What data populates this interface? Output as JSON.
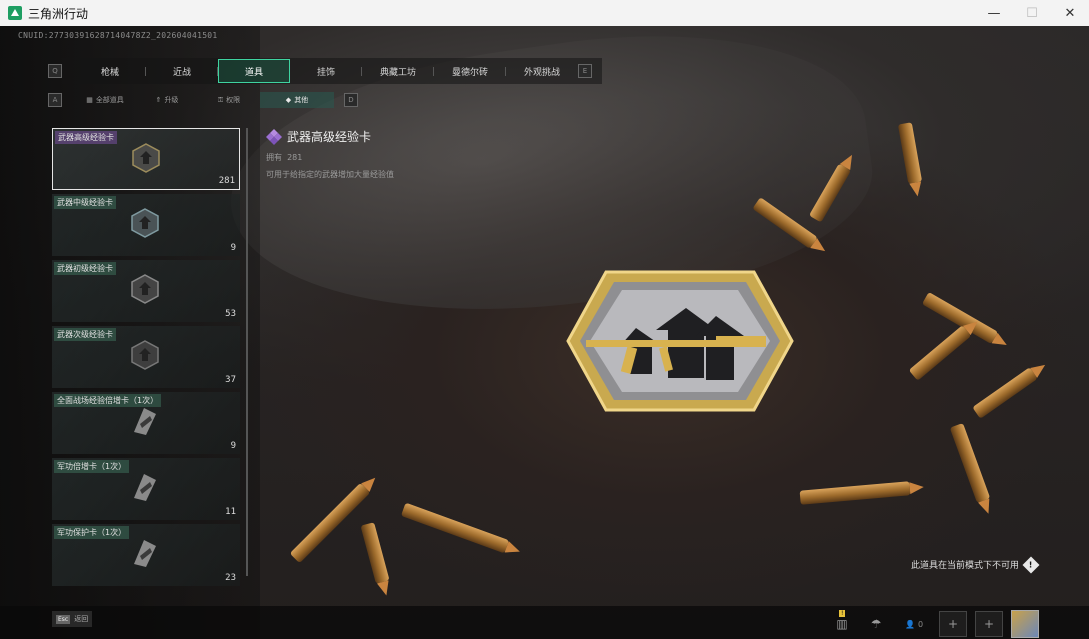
{
  "window": {
    "title": "三角洲行动",
    "minimize": "—",
    "maximize": "☐",
    "close": "✕"
  },
  "uid": "CNUID:277303916287140478Z2_202604041501",
  "tabs": {
    "prev_key": "Q",
    "next_key": "E",
    "items": [
      {
        "label": "枪械",
        "active": false
      },
      {
        "label": "近战",
        "active": false
      },
      {
        "label": "道具",
        "active": true
      },
      {
        "label": "挂饰",
        "active": false
      },
      {
        "label": "典藏工坊",
        "active": false
      },
      {
        "label": "曼德尔砖",
        "active": false
      },
      {
        "label": "外观挑战",
        "active": false
      }
    ]
  },
  "subtabs": {
    "prev_key": "A",
    "next_key": "D",
    "items": [
      {
        "label": "全部道具",
        "icon": "grid-icon",
        "active": false
      },
      {
        "label": "升级",
        "icon": "upgrade-icon",
        "active": false
      },
      {
        "label": "权限",
        "icon": "key-icon",
        "active": false
      },
      {
        "label": "其他",
        "icon": "diamond-icon",
        "active": true
      }
    ]
  },
  "items": [
    {
      "name": "武器高级经验卡",
      "count": "281",
      "selected": true
    },
    {
      "name": "武器中级经验卡",
      "count": "9",
      "selected": false
    },
    {
      "name": "武器初级经验卡",
      "count": "53",
      "selected": false
    },
    {
      "name": "武器次级经验卡",
      "count": "37",
      "selected": false
    },
    {
      "name": "全面战场经验倍增卡（1次）",
      "count": "9",
      "selected": false
    },
    {
      "name": "军功倍增卡（1次）",
      "count": "11",
      "selected": false
    },
    {
      "name": "军功保护卡（1次）",
      "count": "23",
      "selected": false
    }
  ],
  "detail": {
    "name": "武器高级经验卡",
    "own_label": "拥有",
    "own_value": "281",
    "description": "可用于给指定的武器增加大量经验值"
  },
  "unavailable_notice": "此道具在当前模式下不可用",
  "bottom": {
    "esc_key": "Esc",
    "esc_label": "返回",
    "stats_badge": "!",
    "friends_count": "0"
  },
  "colors": {
    "accent": "#3fd3a0",
    "selected_label": "#7a4fa6",
    "gold": "#d6b35a"
  }
}
